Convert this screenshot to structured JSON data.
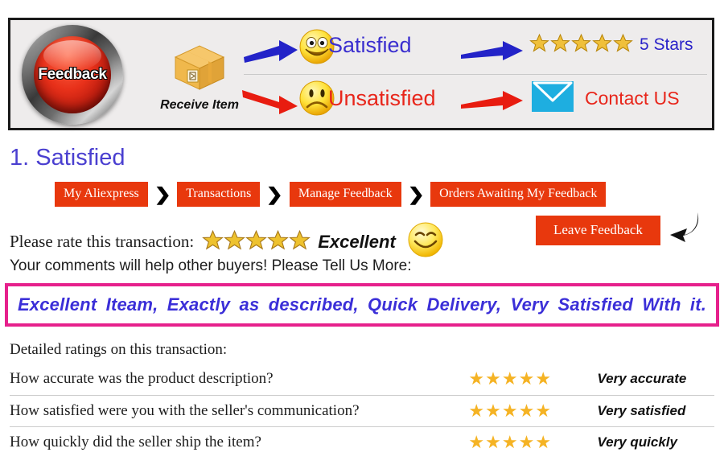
{
  "banner": {
    "feedback_button_label": "Feedback",
    "receive_item_label": "Receive Item",
    "satisfied_label": "Satisfied",
    "unsatisfied_label": "Unsatisfied",
    "five_stars_label": "5 Stars",
    "contact_label": "Contact US",
    "icons": {
      "package": "package-box-icon",
      "smiley_happy": "happy-face-icon",
      "smiley_sad": "sad-face-icon",
      "arrow_blue": "blue-right-arrow-icon",
      "arrow_red": "red-right-arrow-icon",
      "envelope": "envelope-icon",
      "star": "gold-star-icon"
    },
    "colors": {
      "satisfied_text": "#3b2fcf",
      "unsatisfied_text": "#e8261b",
      "five_stars_text": "#2a22c9",
      "envelope": "#1eaee0",
      "button_red": "#e8311a",
      "arrow_blue": "#2323c8",
      "arrow_red": "#e81c10"
    },
    "star_count": 5
  },
  "section": {
    "title": "1. Satisfied"
  },
  "breadcrumb": {
    "separator": "❯",
    "items": [
      {
        "label": "My Aliexpress"
      },
      {
        "label": "Transactions"
      },
      {
        "label": "Manage Feedback"
      },
      {
        "label": "Orders Awaiting My Feedback"
      }
    ],
    "color": "#e8380d"
  },
  "rate": {
    "label": "Please rate this transaction:",
    "star_count": 5,
    "rating_word": "Excellent",
    "smiley_icon": "happy-face-icon",
    "leave_feedback_label": "Leave Feedback",
    "pointer_icon": "curved-arrow-icon"
  },
  "comments": {
    "prompt": "Your comments will help other buyers! Please Tell Us More:",
    "text": "Excellent Iteam, Exactly as described, Quick Delivery, Very Satisfied With it.",
    "box_border_color": "#e6208c",
    "text_color": "#3b2fd8"
  },
  "detailed": {
    "heading": "Detailed ratings on this transaction:",
    "star_color": "#f5b324",
    "rows": [
      {
        "question": "How accurate was the product description?",
        "stars": 5,
        "answer": "Very accurate"
      },
      {
        "question": "How satisfied were you with the seller's communication?",
        "stars": 5,
        "answer": "Very satisfied"
      },
      {
        "question": "How quickly did the seller ship the item?",
        "stars": 5,
        "answer": "Very quickly"
      }
    ]
  }
}
